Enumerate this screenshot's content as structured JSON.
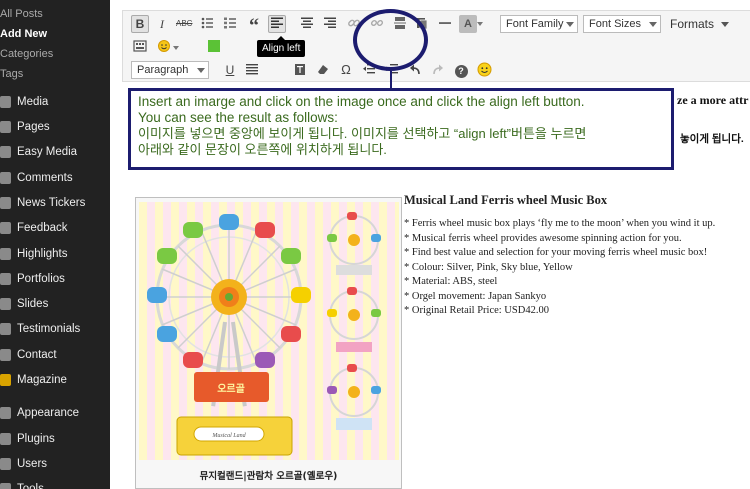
{
  "sidebar": {
    "submenu": [
      {
        "label": "All Posts",
        "current": false
      },
      {
        "label": "Add New",
        "current": true
      },
      {
        "label": "Categories",
        "current": false
      },
      {
        "label": "Tags",
        "current": false
      }
    ],
    "menu": [
      {
        "label": "Media",
        "icon": "media-icon"
      },
      {
        "label": "Pages",
        "icon": "pages-icon"
      },
      {
        "label": "Easy Media",
        "icon": "easy-media-icon"
      },
      {
        "label": "Comments",
        "icon": "comments-icon"
      },
      {
        "label": "News Tickers",
        "icon": "news-tickers-icon"
      },
      {
        "label": "Feedback",
        "icon": "feedback-icon"
      },
      {
        "label": "Highlights",
        "icon": "highlights-icon"
      },
      {
        "label": "Portfolios",
        "icon": "portfolios-icon"
      },
      {
        "label": "Slides",
        "icon": "slides-icon"
      },
      {
        "label": "Testimonials",
        "icon": "testimonials-icon"
      },
      {
        "label": "Contact",
        "icon": "contact-icon"
      },
      {
        "label": "Magazine",
        "icon": "magazine-icon"
      },
      {
        "label": "Appearance",
        "icon": "appearance-icon"
      },
      {
        "label": "Plugins",
        "icon": "plugins-icon"
      },
      {
        "label": "Users",
        "icon": "users-icon"
      },
      {
        "label": "Tools",
        "icon": "tools-icon"
      }
    ]
  },
  "toolbar": {
    "font_family": "Font Family",
    "font_sizes": "Font Sizes",
    "formats": "Formats",
    "paragraph": "Paragraph",
    "bold_label": "B",
    "italic_label": "I",
    "strike_label": "ABC",
    "quote_label": "“",
    "underline_label": "U",
    "omega_label": "Ω",
    "help_label": "?",
    "font_color_label": "A",
    "tooltip": "Align left",
    "accent_color": "#1c1c6f"
  },
  "note": {
    "line1": "Insert an imarge and click on the image once and click the align left button.",
    "line2": "You can see the result as follows:",
    "line3": "이미지를 넣으면 중앙에 보이게 됩니다. 이미지를 선택하고 “align left”버튼을 누르면",
    "line4": "아래와 같이 문장이 오른쪽에 위치하게 됩니다.",
    "text_color": "#3a6a1e"
  },
  "content": {
    "cut_line1": "ze a more attr",
    "cut_line2": "놓이게 됩니다.",
    "image_caption": "뮤지컬랜드|관람차 오르골(옐로우)",
    "image_lettering": [
      "오르골",
      "Musical Land"
    ],
    "product_title": "Musical Land Ferris wheel Music Box",
    "product_items": [
      "* Ferris wheel music box plays ‘fly me to the moon’ when you wind it up.",
      "* Musical ferris wheel provides awesome spinning action for you.",
      "* Find best value and selection for your moving ferris wheel music box!",
      "* Colour: Silver, Pink, Sky blue, Yellow",
      "* Material: ABS, steel",
      "* Orgel movement: Japan Sankyo",
      "* Original Retail Price: USD42.00"
    ]
  }
}
